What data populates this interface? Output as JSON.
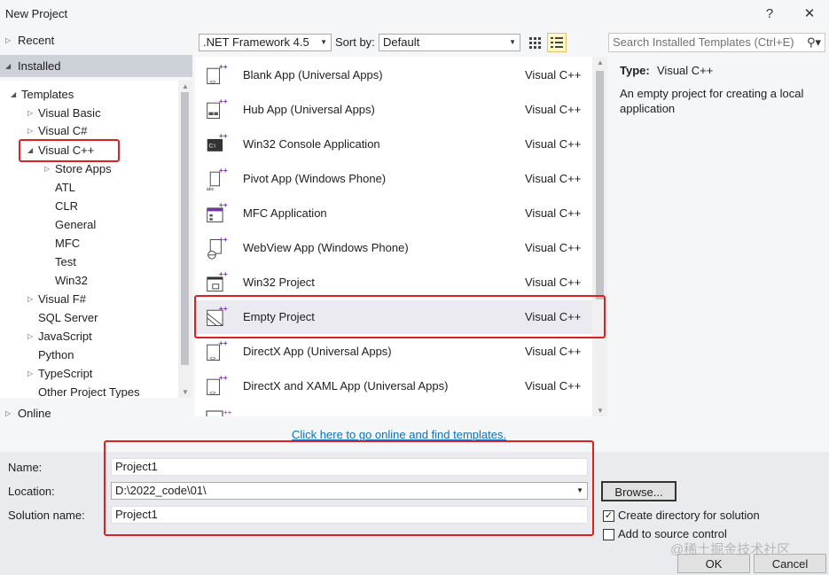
{
  "window": {
    "title": "New Project",
    "help_glyph": "?",
    "close_glyph": "✕"
  },
  "nav": {
    "recent": "Recent",
    "installed": "Installed",
    "online": "Online",
    "tree": {
      "templates": "Templates",
      "visual_basic": "Visual Basic",
      "visual_csharp": "Visual C#",
      "visual_cpp": "Visual C++",
      "store_apps": "Store Apps",
      "atl": "ATL",
      "clr": "CLR",
      "general": "General",
      "mfc": "MFC",
      "test": "Test",
      "win32": "Win32",
      "visual_fsharp": "Visual F#",
      "sql_server": "SQL Server",
      "javascript": "JavaScript",
      "python": "Python",
      "typescript": "TypeScript",
      "other": "Other Project Types"
    }
  },
  "toolbar": {
    "framework": ".NET Framework 4.5",
    "sort_label": "Sort by:",
    "sort_value": "Default",
    "search_placeholder": "Search Installed Templates (Ctrl+E)"
  },
  "templates": [
    {
      "name": "Blank App (Universal Apps)",
      "lang": "Visual C++",
      "icon": "blank-app-icon"
    },
    {
      "name": "Hub App (Universal Apps)",
      "lang": "Visual C++",
      "icon": "hub-app-icon"
    },
    {
      "name": "Win32 Console Application",
      "lang": "Visual C++",
      "icon": "console-app-icon"
    },
    {
      "name": "Pivot App (Windows Phone)",
      "lang": "Visual C++",
      "icon": "pivot-app-icon"
    },
    {
      "name": "MFC Application",
      "lang": "Visual C++",
      "icon": "mfc-app-icon"
    },
    {
      "name": "WebView App (Windows Phone)",
      "lang": "Visual C++",
      "icon": "webview-app-icon"
    },
    {
      "name": "Win32 Project",
      "lang": "Visual C++",
      "icon": "win32-project-icon"
    },
    {
      "name": "Empty Project",
      "lang": "Visual C++",
      "icon": "empty-project-icon"
    },
    {
      "name": "DirectX App (Universal Apps)",
      "lang": "Visual C++",
      "icon": "directx-app-icon"
    },
    {
      "name": "DirectX and XAML App (Universal Apps)",
      "lang": "Visual C++",
      "icon": "directx-xaml-app-icon"
    }
  ],
  "online_link": "Click here to go online and find templates.",
  "info": {
    "type_label": "Type:",
    "type_value": "Visual C++",
    "description": "An empty project for creating a local application"
  },
  "form": {
    "name_label": "Name:",
    "name_value": "Project1",
    "location_label": "Location:",
    "location_value": "D:\\2022_code\\01\\",
    "solution_label": "Solution name:",
    "solution_value": "Project1",
    "browse": "Browse...",
    "create_dir": "Create directory for solution",
    "create_dir_checked": true,
    "source_control": "Add to source control",
    "source_control_checked": false,
    "ok": "OK",
    "cancel": "Cancel"
  },
  "watermark": "@稀土掘金技术社区",
  "colors": {
    "highlight_red": "#e02020",
    "link_blue": "#0e70c0",
    "selected_row": "#eaeaf0"
  }
}
